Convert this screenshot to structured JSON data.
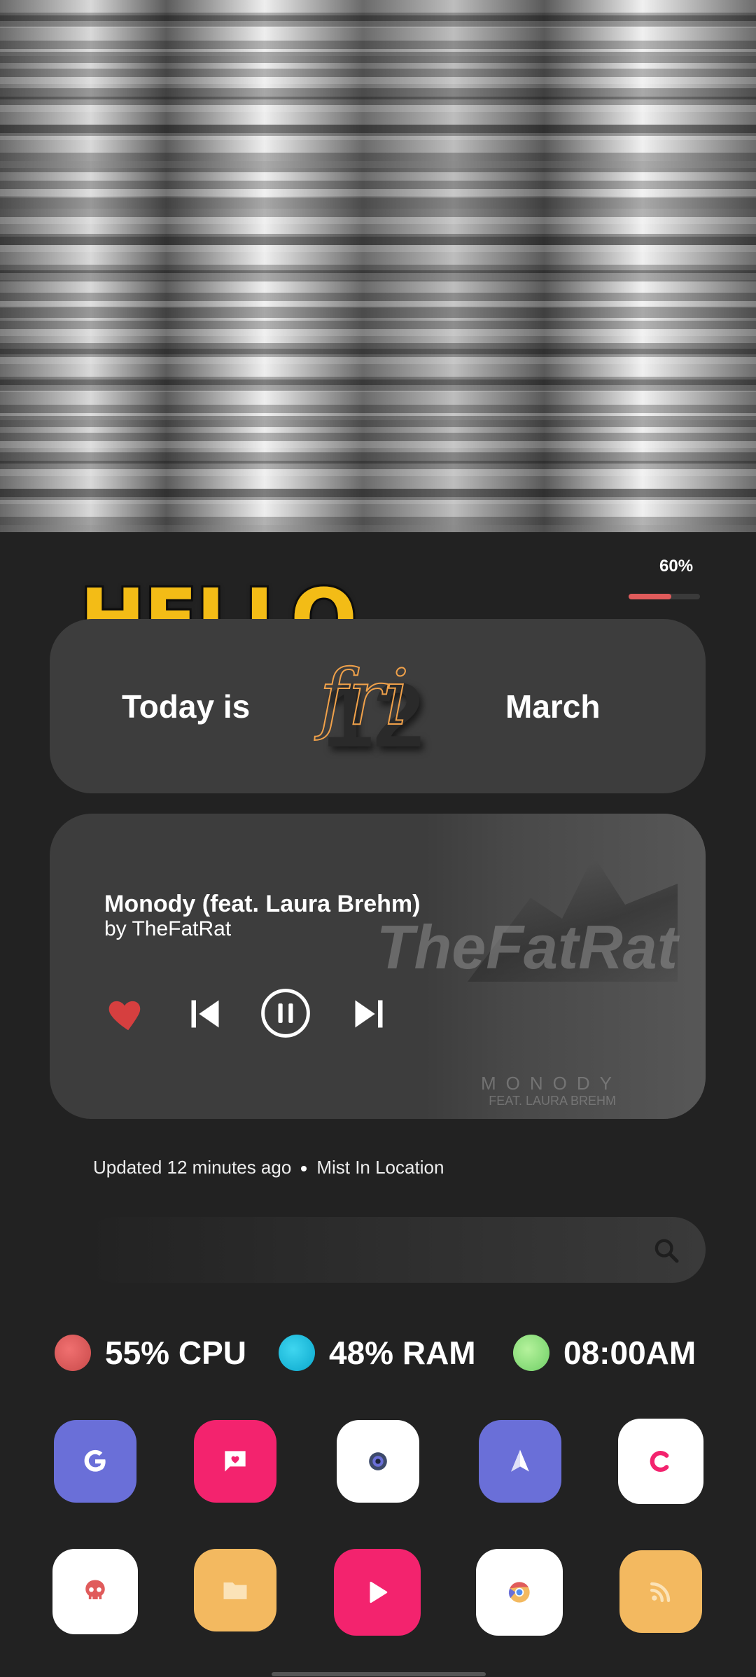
{
  "battery": {
    "percent_text": "60%",
    "level": 0.6,
    "fill_color": "#e05b5b"
  },
  "greeting": "HELLO",
  "date_card": {
    "prefix": "Today is",
    "day_number": "12",
    "weekday": "fri",
    "month": "March"
  },
  "music": {
    "title": "Monody (feat. Laura Brehm)",
    "artist": "by TheFatRat",
    "album_brand": "TheFatRat",
    "album_title": "MONODY",
    "album_subtitle": "FEAT. LAURA BREHM",
    "icons": [
      "heart-icon",
      "skip-previous-icon",
      "pause-icon",
      "skip-next-icon"
    ]
  },
  "weather": {
    "updated": "Updated 12 minutes ago",
    "condition": "Mist In Location"
  },
  "search": {
    "icon": "search-icon"
  },
  "stats": [
    {
      "label": "55% CPU",
      "color": "#e05b5b"
    },
    {
      "label": "48% RAM",
      "color": "#11c1e0"
    },
    {
      "label": "08:00AM",
      "color": "#8ee27c"
    }
  ],
  "apps": [
    {
      "name": "google",
      "bg": "#6a6fd8",
      "icon": "g-icon"
    },
    {
      "name": "messages",
      "bg": "#f3236e",
      "icon": "chat-heart-icon"
    },
    {
      "name": "camera",
      "bg": "#ffffff",
      "icon": "camera-icon"
    },
    {
      "name": "send",
      "bg": "#6a6fd8",
      "icon": "paper-plane-icon"
    },
    {
      "name": "c-app",
      "bg": "#ffffff",
      "icon": "c-icon"
    },
    {
      "name": "skull",
      "bg": "#ffffff",
      "icon": "skull-icon"
    },
    {
      "name": "files",
      "bg": "#f3b960",
      "icon": "folder-icon"
    },
    {
      "name": "play",
      "bg": "#f3236e",
      "icon": "play-icon"
    },
    {
      "name": "chrome",
      "bg": "#ffffff",
      "icon": "chrome-icon"
    },
    {
      "name": "feed",
      "bg": "#f3b960",
      "icon": "rss-icon"
    }
  ]
}
